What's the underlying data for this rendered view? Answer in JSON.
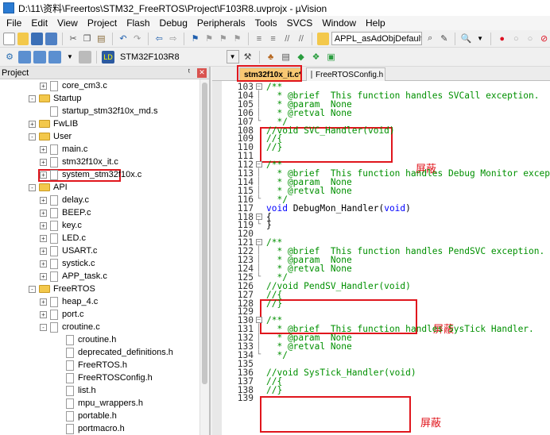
{
  "window": {
    "title": "D:\\11\\资料\\Freertos\\STM32_FreeRTOS\\Project\\F103R8.uvprojx - µVision"
  },
  "menu": [
    "File",
    "Edit",
    "View",
    "Project",
    "Flash",
    "Debug",
    "Peripherals",
    "Tools",
    "SVCS",
    "Window",
    "Help"
  ],
  "toolbar": {
    "function_combo": "APPL_asAdObjDefaultMa",
    "target": "STM32F103R8"
  },
  "project_panel": {
    "title": "Project",
    "items": [
      {
        "label": "core_cm3.c",
        "type": "file",
        "indent": 3,
        "expander": "+"
      },
      {
        "label": "Startup",
        "type": "folder",
        "indent": 2,
        "expander": "-"
      },
      {
        "label": "startup_stm32f10x_md.s",
        "type": "file",
        "indent": 3,
        "expander": ""
      },
      {
        "label": "FwLIB",
        "type": "folder",
        "indent": 2,
        "expander": "+"
      },
      {
        "label": "User",
        "type": "folder",
        "indent": 2,
        "expander": "-"
      },
      {
        "label": "main.c",
        "type": "file",
        "indent": 3,
        "expander": "+"
      },
      {
        "label": "stm32f10x_it.c",
        "type": "file",
        "indent": 3,
        "expander": "+"
      },
      {
        "label": "system_stm32f10x.c",
        "type": "file",
        "indent": 3,
        "expander": "+"
      },
      {
        "label": "API",
        "type": "folder",
        "indent": 2,
        "expander": "-"
      },
      {
        "label": "delay.c",
        "type": "file",
        "indent": 3,
        "expander": "+"
      },
      {
        "label": "BEEP.c",
        "type": "file",
        "indent": 3,
        "expander": "+"
      },
      {
        "label": "key.c",
        "type": "file",
        "indent": 3,
        "expander": "+"
      },
      {
        "label": "LED.c",
        "type": "file",
        "indent": 3,
        "expander": "+"
      },
      {
        "label": "USART.c",
        "type": "file",
        "indent": 3,
        "expander": "+"
      },
      {
        "label": "systick.c",
        "type": "file",
        "indent": 3,
        "expander": "+"
      },
      {
        "label": "APP_task.c",
        "type": "file",
        "indent": 3,
        "expander": "+"
      },
      {
        "label": "FreeRTOS",
        "type": "folder",
        "indent": 2,
        "expander": "-"
      },
      {
        "label": "heap_4.c",
        "type": "file",
        "indent": 3,
        "expander": "+"
      },
      {
        "label": "port.c",
        "type": "file",
        "indent": 3,
        "expander": "+"
      },
      {
        "label": "croutine.c",
        "type": "file",
        "indent": 3,
        "expander": "-"
      },
      {
        "label": "croutine.h",
        "type": "file",
        "indent": 4,
        "expander": ""
      },
      {
        "label": "deprecated_definitions.h",
        "type": "file",
        "indent": 4,
        "expander": ""
      },
      {
        "label": "FreeRTOS.h",
        "type": "file",
        "indent": 4,
        "expander": ""
      },
      {
        "label": "FreeRTOSConfig.h",
        "type": "file",
        "indent": 4,
        "expander": ""
      },
      {
        "label": "list.h",
        "type": "file",
        "indent": 4,
        "expander": ""
      },
      {
        "label": "mpu_wrappers.h",
        "type": "file",
        "indent": 4,
        "expander": ""
      },
      {
        "label": "portable.h",
        "type": "file",
        "indent": 4,
        "expander": ""
      },
      {
        "label": "portmacro.h",
        "type": "file",
        "indent": 4,
        "expander": ""
      }
    ]
  },
  "editor": {
    "tabs": [
      {
        "label": "stm32f10x_it.c*",
        "active": true
      },
      {
        "label": "FreeRTOSConfig.h",
        "active": false
      }
    ],
    "lines": [
      {
        "n": "103",
        "fold": "box-",
        "text": "/**",
        "style": "comment"
      },
      {
        "n": "104",
        "fold": "bar",
        "text": "  * @brief  This function handles SVCall exception.",
        "style": "comment"
      },
      {
        "n": "105",
        "fold": "bar",
        "text": "  * @param  None",
        "style": "comment"
      },
      {
        "n": "106",
        "fold": "bar",
        "text": "  * @retval None",
        "style": "comment"
      },
      {
        "n": "107",
        "fold": "end",
        "text": "  */",
        "style": "comment"
      },
      {
        "n": "108",
        "fold": "",
        "text": "//void SVC_Handler(void)",
        "style": "comment"
      },
      {
        "n": "109",
        "fold": "",
        "text": "//{",
        "style": "comment"
      },
      {
        "n": "110",
        "fold": "",
        "text": "//}",
        "style": "comment"
      },
      {
        "n": "111",
        "fold": "",
        "text": "",
        "style": "plain"
      },
      {
        "n": "112",
        "fold": "box-",
        "text": "/**",
        "style": "comment"
      },
      {
        "n": "113",
        "fold": "bar",
        "text": "  * @brief  This function handles Debug Monitor exception.",
        "style": "comment"
      },
      {
        "n": "114",
        "fold": "bar",
        "text": "  * @param  None",
        "style": "comment"
      },
      {
        "n": "115",
        "fold": "bar",
        "text": "  * @retval None",
        "style": "comment"
      },
      {
        "n": "116",
        "fold": "end",
        "text": "  */",
        "style": "comment"
      },
      {
        "n": "117",
        "fold": "",
        "text": "void DebugMon_Handler(void)",
        "style": "code"
      },
      {
        "n": "118",
        "fold": "box-",
        "text": "{",
        "style": "plain"
      },
      {
        "n": "119",
        "fold": "end",
        "text": "}",
        "style": "plain"
      },
      {
        "n": "120",
        "fold": "",
        "text": "",
        "style": "plain"
      },
      {
        "n": "121",
        "fold": "box-",
        "text": "/**",
        "style": "comment"
      },
      {
        "n": "122",
        "fold": "bar",
        "text": "  * @brief  This function handles PendSVC exception.",
        "style": "comment"
      },
      {
        "n": "123",
        "fold": "bar",
        "text": "  * @param  None",
        "style": "comment"
      },
      {
        "n": "124",
        "fold": "bar",
        "text": "  * @retval None",
        "style": "comment"
      },
      {
        "n": "125",
        "fold": "end",
        "text": "  */",
        "style": "comment"
      },
      {
        "n": "126",
        "fold": "",
        "text": "//void PendSV_Handler(void)",
        "style": "comment"
      },
      {
        "n": "127",
        "fold": "",
        "text": "//{",
        "style": "comment"
      },
      {
        "n": "128",
        "fold": "",
        "text": "//}",
        "style": "comment"
      },
      {
        "n": "129",
        "fold": "",
        "text": "",
        "style": "plain"
      },
      {
        "n": "130",
        "fold": "box-",
        "text": "/**",
        "style": "comment"
      },
      {
        "n": "131",
        "fold": "bar",
        "text": "  * @brief  This function handles SysTick Handler.",
        "style": "comment"
      },
      {
        "n": "132",
        "fold": "bar",
        "text": "  * @param  None",
        "style": "comment"
      },
      {
        "n": "133",
        "fold": "bar",
        "text": "  * @retval None",
        "style": "comment"
      },
      {
        "n": "134",
        "fold": "end",
        "text": "  */",
        "style": "comment"
      },
      {
        "n": "135",
        "fold": "",
        "text": "",
        "style": "plain"
      },
      {
        "n": "136",
        "fold": "",
        "text": "//void SysTick_Handler(void)",
        "style": "comment"
      },
      {
        "n": "137",
        "fold": "",
        "text": "//{",
        "style": "comment"
      },
      {
        "n": "138",
        "fold": "",
        "text": "//}",
        "style": "comment"
      },
      {
        "n": "139",
        "fold": "",
        "text": "",
        "style": "plain"
      }
    ],
    "annotations": [
      "屏蔽",
      "屏蔽",
      "屏蔽"
    ]
  },
  "colors": {
    "comment": "#009000",
    "keyword": "#0000ff",
    "highlight": "#e0161d",
    "active_tab": "#f8c873"
  }
}
